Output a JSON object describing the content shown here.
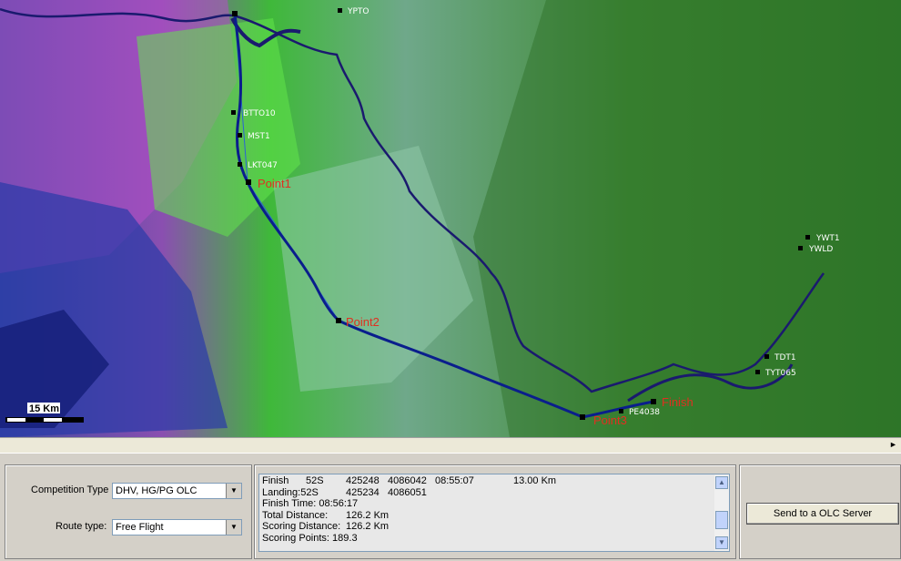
{
  "map": {
    "waypoints": [
      "YPTO",
      "BTTO10",
      "MST1",
      "LKT047",
      "YWT1",
      "YWLD",
      "TDT1",
      "TYT065",
      "PE4038"
    ],
    "turnpoints": [
      "Point1",
      "Point2",
      "Point3",
      "Finish"
    ],
    "scale_label": "15 Km",
    "colors": {
      "track": "#0a1e8c",
      "turnpoint_label": "#e03020",
      "river": "#1a1a6e"
    }
  },
  "controls": {
    "competition_type_label": "Competition Type",
    "competition_type_value": "DHV, HG/PG OLC",
    "route_type_label": "Route type:",
    "route_type_value": "Free Flight",
    "send_button": "Send to a OLC Server"
  },
  "results": {
    "rows": [
      [
        "Finish",
        "52S",
        "425248",
        "4086042",
        "08:55:07",
        "13.00 Km"
      ],
      [
        "Landing:52S",
        "",
        "425234",
        "4086051",
        "",
        ""
      ],
      [
        "Finish Time: 08:56:17",
        "",
        "",
        "",
        "",
        ""
      ],
      [
        "Total Distance:",
        "",
        "126.2 Km",
        "",
        "",
        ""
      ],
      [
        "Scoring Distance:",
        "",
        "126.2 Km",
        "",
        "",
        ""
      ],
      [
        "Scoring Points: 189.3",
        "",
        "",
        "",
        "",
        ""
      ]
    ]
  }
}
